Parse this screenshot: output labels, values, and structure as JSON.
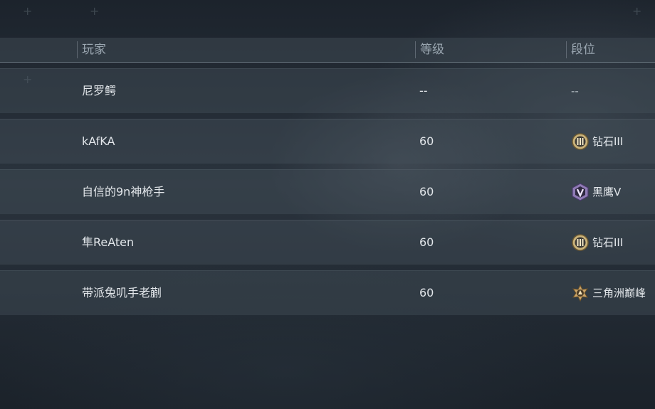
{
  "table": {
    "headers": {
      "player": "玩家",
      "level": "等级",
      "rank": "段位"
    },
    "rows": [
      {
        "player": "尼罗鳄",
        "level": "--",
        "rank": "--",
        "badge": "none"
      },
      {
        "player": "kAfKA",
        "level": "60",
        "rank": "钻石III",
        "badge": "diamond-III-icon"
      },
      {
        "player": "自信的9n神枪手",
        "level": "60",
        "rank": "黑鹰V",
        "badge": "blackhawk-V-icon"
      },
      {
        "player": "隼ReAten",
        "level": "60",
        "rank": "钻石III",
        "badge": "diamond-III-icon"
      },
      {
        "player": "带派兔叽手老蒯",
        "level": "60",
        "rank": "三角洲巅峰",
        "badge": "delta-peak-icon"
      }
    ]
  },
  "colors": {
    "text": "#e2e6ea",
    "header_text": "#9ba7b1",
    "diamond_badge": "#c9b27a",
    "blackhawk_badge": "#8f7bb5",
    "peak_badge": "#caa56a"
  }
}
